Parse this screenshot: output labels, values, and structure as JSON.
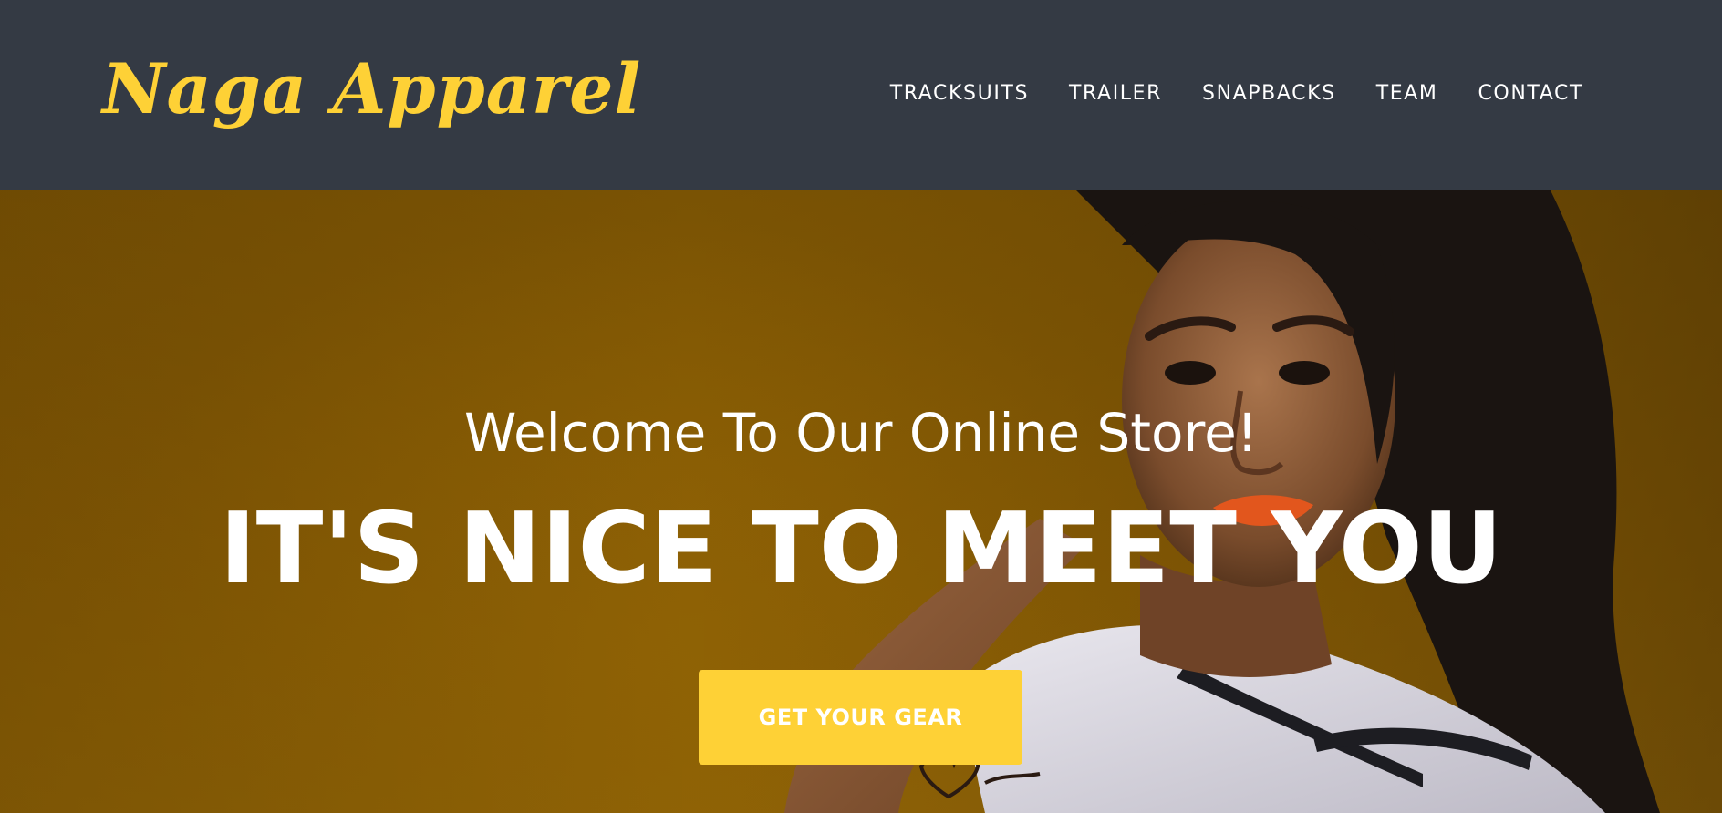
{
  "brand": {
    "name": "Naga Apparel",
    "color": "#fed136"
  },
  "nav": {
    "items": [
      {
        "label": "TRACKSUITS"
      },
      {
        "label": "TRAILER"
      },
      {
        "label": "SNAPBACKS"
      },
      {
        "label": "TEAM"
      },
      {
        "label": "CONTACT"
      }
    ]
  },
  "hero": {
    "lead_in": "Welcome To Our Online Store!",
    "heading": "IT'S NICE TO MEET YOU",
    "cta_label": "GET YOUR GEAR",
    "background_color": "#875b04",
    "image": "photo-woman-in-white-baseball-jersey"
  },
  "colors": {
    "navbar_bg": "#343a44",
    "accent": "#fed136",
    "text": "#ffffff"
  }
}
